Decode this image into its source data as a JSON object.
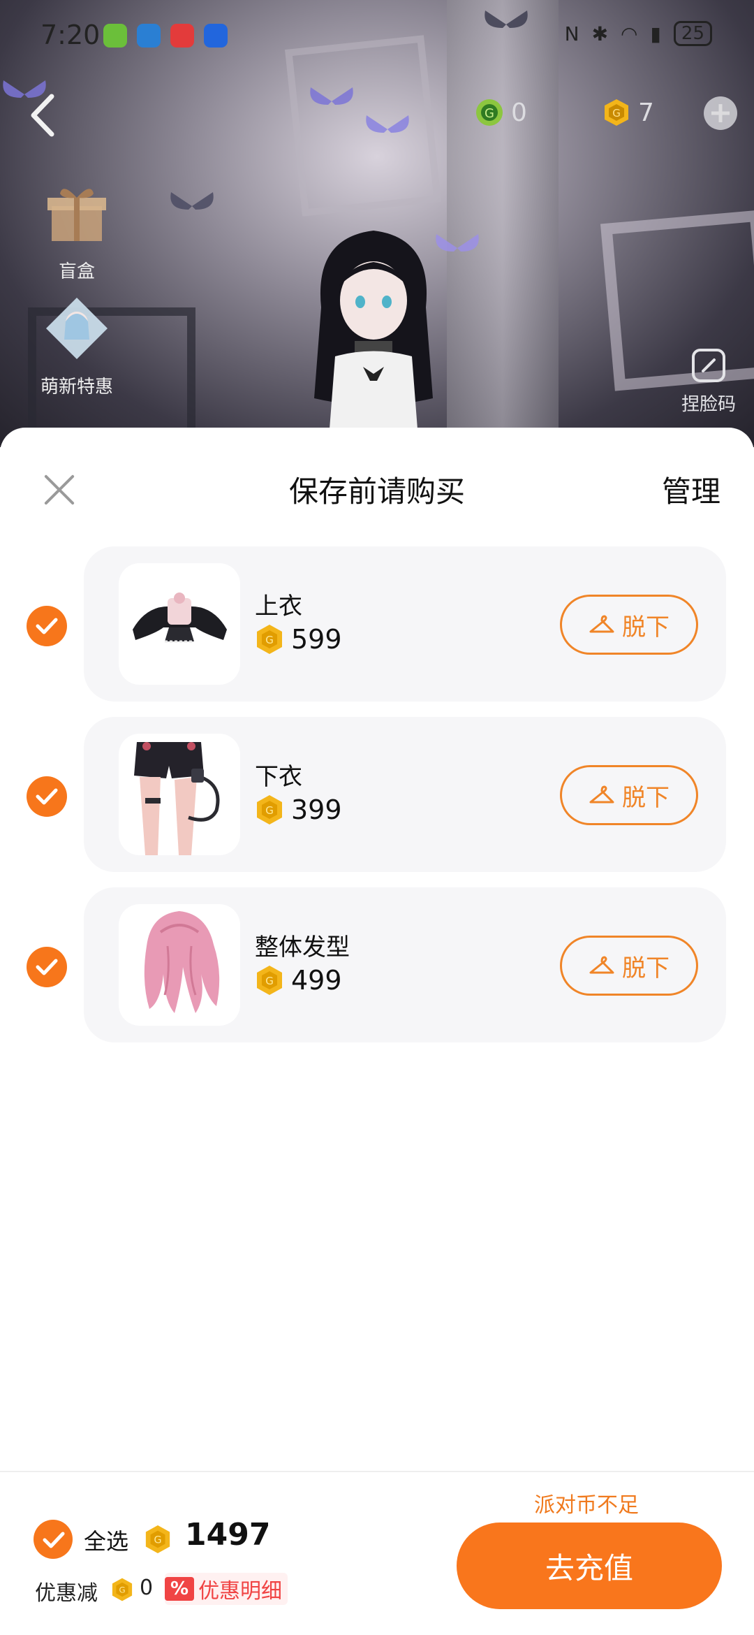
{
  "status_bar": {
    "time": "7:20",
    "battery": "25"
  },
  "top_bar": {
    "currencies": [
      {
        "icon": "green-coin-icon",
        "value": "0",
        "color": "#8cc63f"
      },
      {
        "icon": "gold-coin-icon",
        "value": "7",
        "color": "#f3b51a"
      }
    ]
  },
  "side_menu": [
    {
      "label": "盲盒",
      "icon": "gift-box-icon"
    },
    {
      "label": "萌新特惠",
      "icon": "newbie-offer-icon"
    }
  ],
  "pinch_face": {
    "label": "捏脸码",
    "icon": "edit-face-icon"
  },
  "sheet": {
    "title": "保存前请购买",
    "manage_label": "管理",
    "remove_label": "脱下",
    "items": [
      {
        "name": "上衣",
        "price": "599",
        "checked": true,
        "thumb": "black-jacket"
      },
      {
        "name": "下衣",
        "price": "399",
        "checked": true,
        "thumb": "black-shorts"
      },
      {
        "name": "整体发型",
        "price": "499",
        "checked": true,
        "thumb": "pink-hair"
      }
    ]
  },
  "footer": {
    "select_all_label": "全选",
    "total": "1497",
    "discount_label": "优惠减",
    "discount_value": "0",
    "discount_badge": "%",
    "discount_detail_label": "优惠明细",
    "insufficient_label": "派对币不足",
    "recharge_label": "去充值"
  },
  "colors": {
    "accent": "#f7761b",
    "coin": "#f3b51a",
    "discount_red": "#f04444"
  }
}
